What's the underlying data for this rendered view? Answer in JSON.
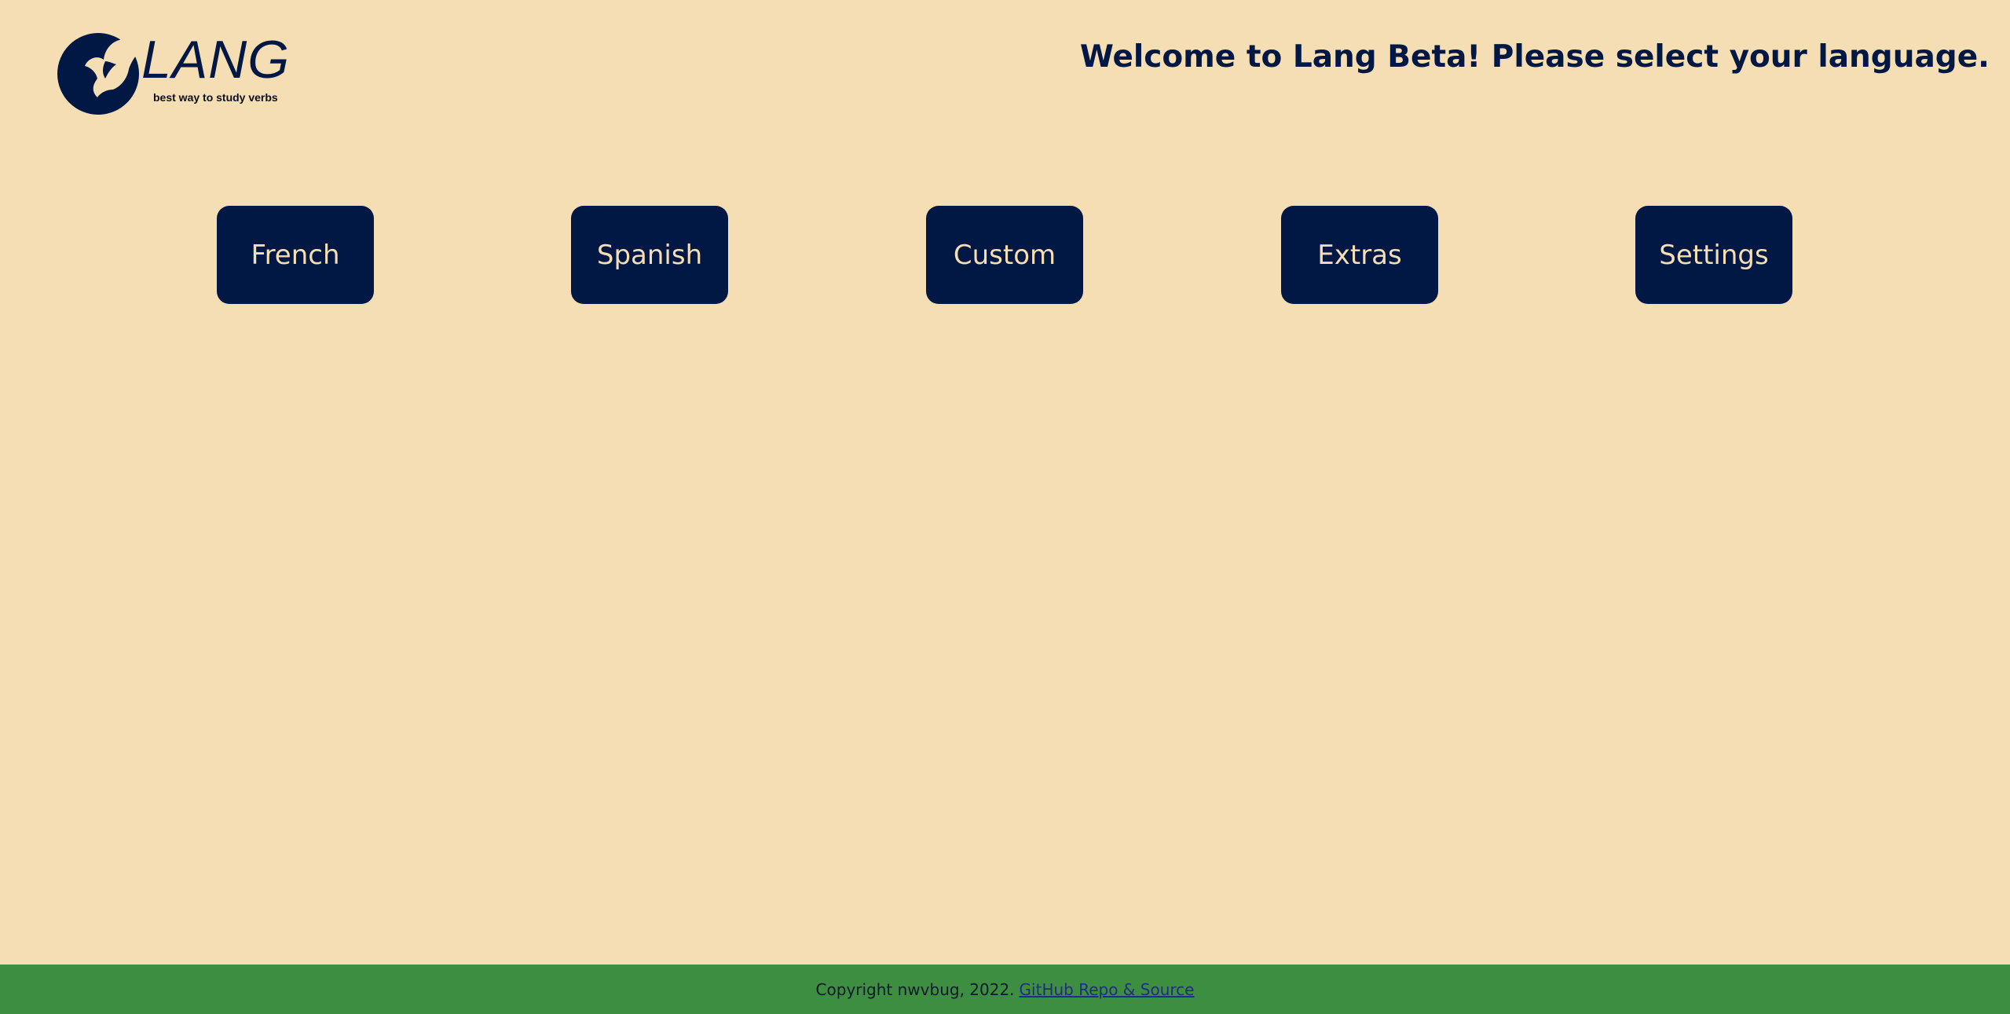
{
  "brand": {
    "name": "LANG",
    "tagline": "best way to study verbs",
    "logo_icon": "crescent-bird-logo",
    "color": "#021844"
  },
  "header": {
    "welcome_text": "Welcome to Lang Beta! Please select your language."
  },
  "menu": {
    "buttons": [
      {
        "label": "French"
      },
      {
        "label": "Spanish"
      },
      {
        "label": "Custom"
      },
      {
        "label": "Extras"
      },
      {
        "label": "Settings"
      }
    ]
  },
  "footer": {
    "copyright": "Copyright nwvbug, 2022.",
    "link_label": "GitHub Repo & Source",
    "background_color": "#3e8e41"
  },
  "colors": {
    "background": "#f5deb3",
    "button_bg": "#021844",
    "button_text": "#f5deb3"
  }
}
